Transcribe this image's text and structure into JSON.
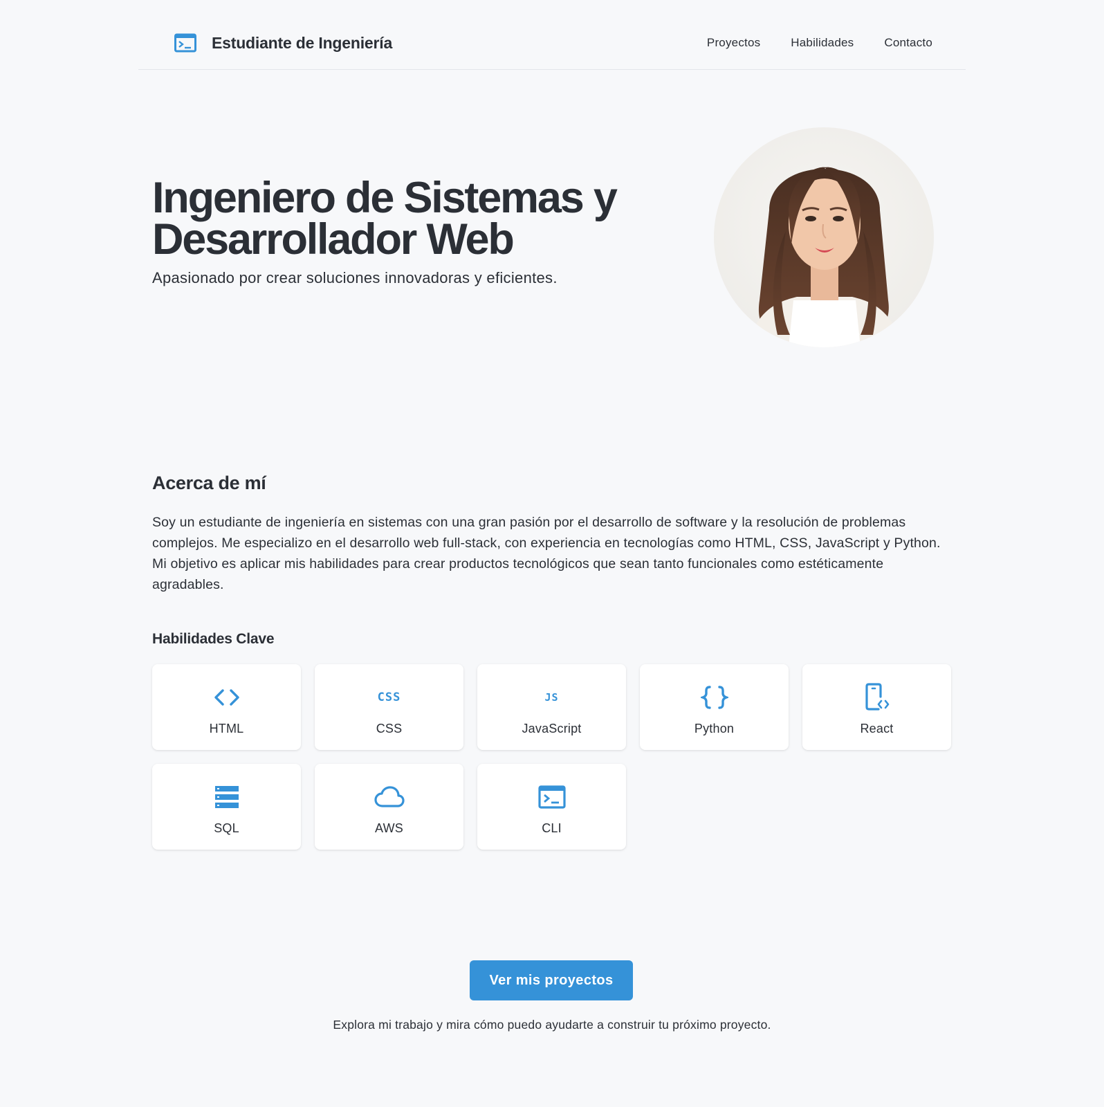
{
  "colors": {
    "accent": "#3592d8",
    "text": "#2b2f36",
    "background": "#f7f8fa"
  },
  "header": {
    "brand_icon": "terminal-icon",
    "title": "Estudiante de Ingeniería",
    "nav": [
      {
        "label": "Proyectos"
      },
      {
        "label": "Habilidades"
      },
      {
        "label": "Contacto"
      }
    ]
  },
  "hero": {
    "title_line1": "Ingeniero de Sistemas y",
    "title_line2": "Desarrollador Web",
    "subtitle": "Apasionado por crear soluciones innovadoras y eficientes."
  },
  "about": {
    "title": "Acerca de mí",
    "text": "Soy un estudiante de ingeniería en sistemas con una gran pasión por el desarrollo de software y la resolución de problemas complejos. Me especializo en el desarrollo web full-stack, con experiencia en tecnologías como HTML, CSS, JavaScript y Python. Mi objetivo es aplicar mis habilidades para crear productos tecnológicos que sean tanto funcionales como estéticamente agradables."
  },
  "skills": {
    "title": "Habilidades Clave",
    "items": [
      {
        "label": "HTML",
        "icon": "code-brackets-icon"
      },
      {
        "label": "CSS",
        "icon": "css-icon",
        "icon_text": "CSS"
      },
      {
        "label": "JavaScript",
        "icon": "js-icon",
        "icon_text": "JS"
      },
      {
        "label": "Python",
        "icon": "curly-braces-icon"
      },
      {
        "label": "React",
        "icon": "mobile-code-icon"
      },
      {
        "label": "SQL",
        "icon": "database-icon"
      },
      {
        "label": "AWS",
        "icon": "cloud-icon"
      },
      {
        "label": "CLI",
        "icon": "terminal-icon"
      }
    ]
  },
  "cta": {
    "button_label": "Ver mis proyectos",
    "subtext": "Explora mi trabajo y mira cómo puedo ayudarte a construir tu próximo proyecto."
  }
}
